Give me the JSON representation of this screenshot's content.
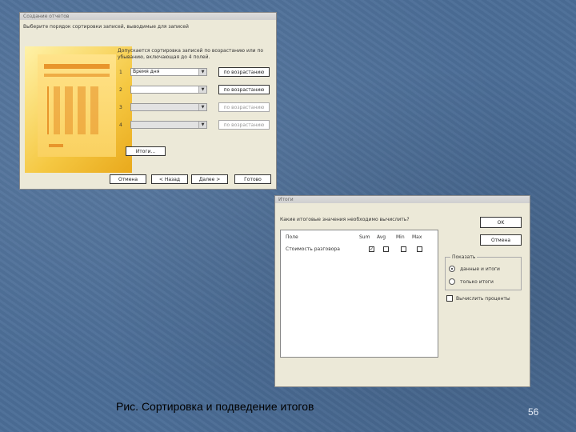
{
  "sort_wizard": {
    "title": "Создание отчетов",
    "prompt": "Выберите порядок сортировки записей, выводимые для записей",
    "description_line1": "Допускается сортировка записей по возрастанию или по",
    "description_line2": "убыванию, включающая до 4 полей.",
    "rows": [
      {
        "num": "1",
        "field": "Время дня",
        "order_label": "по возрастанию"
      },
      {
        "num": "2",
        "field": "",
        "order_label": "по возрастанию"
      },
      {
        "num": "3",
        "field": "",
        "order_label": "по возрастанию"
      },
      {
        "num": "4",
        "field": "",
        "order_label": "по возрастанию"
      }
    ],
    "totals_button": "Итоги...",
    "buttons": {
      "cancel": "Отмена",
      "back": "< Назад",
      "next": "Далее >",
      "finish": "Готово"
    }
  },
  "totals_dialog": {
    "title": "Итоги",
    "question": "Какие итоговые значения необходимо вычислить?",
    "col_field": "Поле",
    "col_sum": "Sum",
    "col_avg": "Avg",
    "col_min": "Min",
    "col_max": "Max",
    "field_name": "Стоимость разговора",
    "sum_checked": true,
    "ok": "OK",
    "cancel": "Отмена",
    "show_legend": "Показать",
    "radio_data_totals": "данные и итоги",
    "radio_only_totals": "только итоги",
    "percent_label": "Вычислить проценты"
  },
  "caption": "Рис. Сортировка и подведение итогов",
  "page_number": "56"
}
